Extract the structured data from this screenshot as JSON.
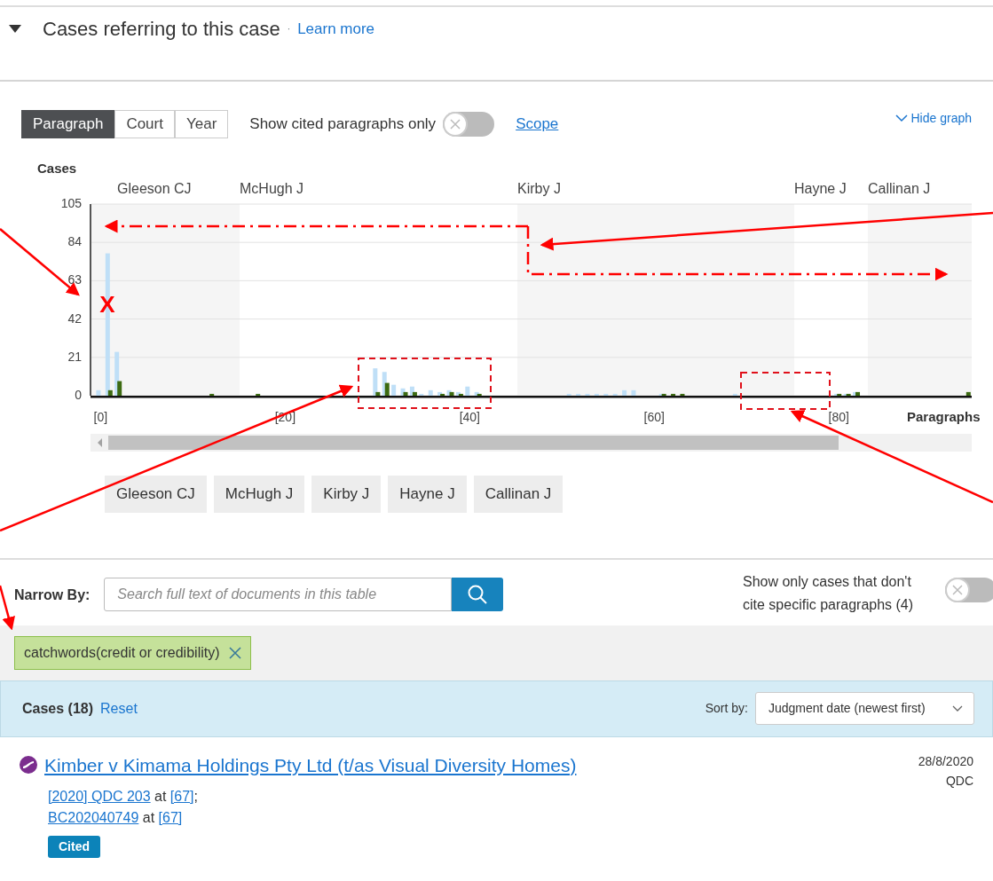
{
  "section": {
    "title": "Cases referring to this case",
    "separator": "·",
    "learn_more": "Learn more",
    "expanded": true
  },
  "view_tabs": [
    {
      "label": "Paragraph",
      "selected": true
    },
    {
      "label": "Court",
      "selected": false
    },
    {
      "label": "Year",
      "selected": false
    }
  ],
  "cited_only": {
    "label": "Show cited paragraphs only",
    "on": false
  },
  "scope_link": "Scope",
  "hide_graph": "Hide graph",
  "chart": {
    "chart_data": {
      "type": "bar",
      "ylabel": "Cases",
      "xlabel": "Paragraphs",
      "xlim": [
        -1,
        94.5
      ],
      "ylim": [
        0,
        105
      ],
      "yticks": [
        0,
        21,
        42,
        63,
        84,
        105
      ],
      "xticks": [
        {
          "value": 0,
          "label": "[0]"
        },
        {
          "value": 20,
          "label": "[20]"
        },
        {
          "value": 40,
          "label": "[40]"
        },
        {
          "value": 60,
          "label": "[60]"
        },
        {
          "value": 80,
          "label": "[80]"
        }
      ],
      "x": [
        0,
        1,
        2,
        3,
        4,
        5,
        6,
        7,
        8,
        9,
        10,
        11,
        12,
        13,
        14,
        15,
        16,
        17,
        18,
        19,
        20,
        21,
        22,
        23,
        24,
        25,
        26,
        27,
        28,
        29,
        30,
        31,
        32,
        33,
        34,
        35,
        36,
        37,
        38,
        39,
        40,
        41,
        42,
        43,
        44,
        45,
        46,
        47,
        48,
        49,
        50,
        51,
        52,
        53,
        54,
        55,
        56,
        57,
        58,
        59,
        60,
        61,
        62,
        63,
        64,
        65,
        66,
        67,
        68,
        69,
        70,
        71,
        72,
        73,
        74,
        75,
        76,
        77,
        78,
        79,
        80,
        81,
        82,
        83,
        84,
        85,
        86,
        87,
        88,
        89,
        90,
        91,
        92,
        93,
        94
      ],
      "series": [
        {
          "color": "#bfdff7",
          "values": [
            3,
            78,
            24,
            0,
            0,
            0,
            0,
            0,
            0,
            0,
            0,
            0,
            0,
            0,
            0,
            0,
            0,
            0,
            0,
            0,
            0,
            0,
            0,
            0,
            0,
            0,
            0,
            0,
            0,
            0,
            15,
            13,
            6,
            4,
            5,
            1,
            3,
            2,
            3,
            2,
            5,
            2,
            0,
            0,
            0,
            0,
            0,
            0,
            0,
            0,
            0,
            1,
            1,
            1,
            1,
            1,
            1,
            3,
            3,
            0,
            0,
            1,
            0,
            0,
            0,
            0,
            0,
            0,
            0,
            1,
            0,
            0,
            0,
            0,
            0,
            0,
            0,
            0,
            0,
            0,
            1,
            1,
            2,
            0,
            0,
            0,
            0,
            0,
            0,
            0,
            0,
            0,
            0,
            0,
            0
          ]
        },
        {
          "color": "#3d6b12",
          "values": [
            0,
            3,
            8,
            0,
            0,
            0,
            0,
            0,
            0,
            0,
            0,
            0,
            1,
            0,
            0,
            0,
            0,
            1,
            0,
            0,
            0,
            0,
            0,
            0,
            0,
            0,
            0,
            0,
            0,
            0,
            2,
            7,
            0,
            2,
            2,
            0,
            0,
            1,
            2,
            1,
            0,
            1,
            0,
            0,
            0,
            0,
            0,
            0,
            0,
            0,
            0,
            0,
            0,
            0,
            0,
            0,
            0,
            0,
            0,
            0,
            0,
            1,
            1,
            1,
            0,
            0,
            0,
            0,
            0,
            0,
            0,
            0,
            0,
            0,
            0,
            0,
            0,
            0,
            0,
            0,
            1,
            1,
            2,
            0,
            0,
            0,
            0,
            0,
            0,
            0,
            0,
            0,
            0,
            0,
            2
          ]
        }
      ],
      "grid": true
    },
    "judges": [
      "Gleeson CJ",
      "McHugh J",
      "Kirby J",
      "Hayne J",
      "Callinan J"
    ]
  },
  "judge_buttons": [
    "Gleeson CJ",
    "McHugh J",
    "Kirby J",
    "Hayne J",
    "Callinan J"
  ],
  "narrow_by": {
    "label": "Narrow By:",
    "placeholder": "Search full text of documents in this table"
  },
  "no_specific": {
    "label": "Show only cases that don't cite specific paragraphs (4)",
    "on": false
  },
  "filters": [
    {
      "label": "catchwords(credit or credibility)"
    }
  ],
  "results_header": {
    "count": "Cases (18)",
    "reset": "Reset",
    "sort_label": "Sort by:",
    "sort_value": "Judgment date (newest first)"
  },
  "results": [
    {
      "title": "Kimber v Kimama Holdings Pty Ltd (t/as Visual Diversity Homes)",
      "citations": [
        {
          "ref": "[2020] QDC 203",
          "at": "at",
          "para": "[67]",
          "end": ";"
        },
        {
          "ref": "BC202040749",
          "at": "at",
          "para": "[67]"
        }
      ],
      "date": "28/8/2020",
      "court": "QDC",
      "badge": "Cited"
    }
  ],
  "annotation_mark": "X"
}
